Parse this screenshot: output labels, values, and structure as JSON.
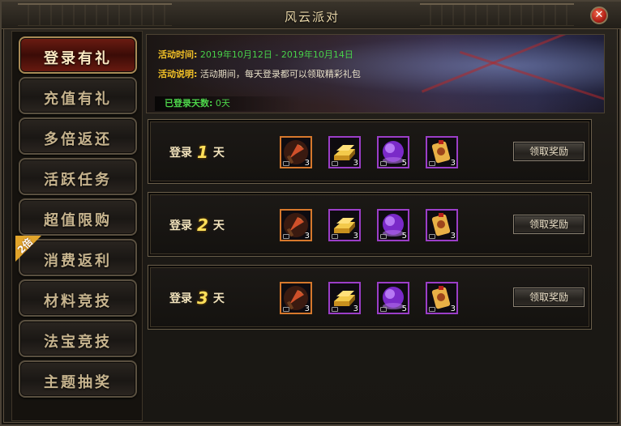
{
  "window": {
    "title": "风云派对"
  },
  "sidebar": {
    "items": [
      {
        "label": "登录有礼",
        "active": true
      },
      {
        "label": "充值有礼"
      },
      {
        "label": "多倍返还"
      },
      {
        "label": "活跃任务"
      },
      {
        "label": "超值限购"
      },
      {
        "label": "消费返利",
        "badge": "2倍"
      },
      {
        "label": "材料竞技"
      },
      {
        "label": "法宝竞技"
      },
      {
        "label": "主题抽奖"
      }
    ]
  },
  "banner": {
    "time_key": "活动时间:",
    "time_value": "2019年10月12日 - 2019年10月14日",
    "desc_key": "活动说明:",
    "desc_value": "活动期间，每天登录都可以领取精彩礼包",
    "days_key": "已登录天数:",
    "days_value": "0天"
  },
  "rewards": [
    {
      "prefix": "登录",
      "day": "1",
      "suffix": "天",
      "button": "领取奖励",
      "items": [
        {
          "icon": "axe-icon",
          "count": "3",
          "rarity": "orange"
        },
        {
          "icon": "gold-bar-icon",
          "count": "3",
          "rarity": "purple"
        },
        {
          "icon": "purple-orb-icon",
          "count": "5",
          "rarity": "purple"
        },
        {
          "icon": "talisman-icon",
          "count": "3",
          "rarity": "purple"
        }
      ]
    },
    {
      "prefix": "登录",
      "day": "2",
      "suffix": "天",
      "button": "领取奖励",
      "items": [
        {
          "icon": "axe-icon",
          "count": "3",
          "rarity": "orange"
        },
        {
          "icon": "gold-bar-icon",
          "count": "3",
          "rarity": "purple"
        },
        {
          "icon": "purple-orb-icon",
          "count": "5",
          "rarity": "purple"
        },
        {
          "icon": "talisman-icon",
          "count": "3",
          "rarity": "purple"
        }
      ]
    },
    {
      "prefix": "登录",
      "day": "3",
      "suffix": "天",
      "button": "领取奖励",
      "items": [
        {
          "icon": "axe-icon",
          "count": "3",
          "rarity": "orange"
        },
        {
          "icon": "gold-bar-icon",
          "count": "3",
          "rarity": "purple"
        },
        {
          "icon": "purple-orb-icon",
          "count": "5",
          "rarity": "purple"
        },
        {
          "icon": "talisman-icon",
          "count": "3",
          "rarity": "purple"
        }
      ]
    }
  ]
}
